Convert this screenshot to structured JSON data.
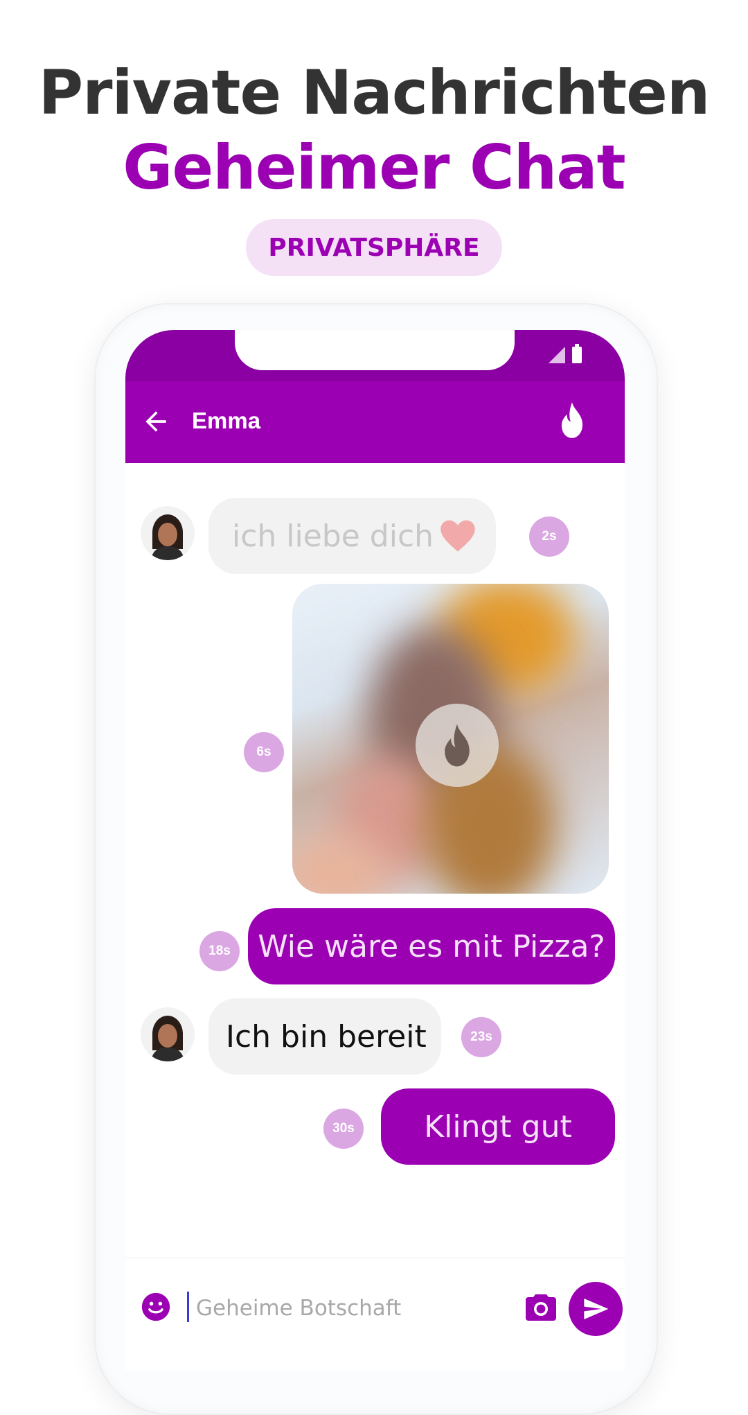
{
  "promo": {
    "title_line1": "Private Nachrichten",
    "title_line2": "Geheimer Chat",
    "badge": "PRIVATSPHÄRE"
  },
  "chat": {
    "contact_name": "Emma",
    "messages": [
      {
        "direction": "incoming",
        "text": "ich liebe dich",
        "emoji": "heart",
        "timer": "2s",
        "burning": true
      },
      {
        "direction": "outgoing",
        "type": "photo",
        "timer": "6s",
        "blurred": true
      },
      {
        "direction": "outgoing",
        "text": "Wie wäre es mit Pizza?",
        "timer": "18s"
      },
      {
        "direction": "incoming",
        "text": "Ich bin bereit",
        "timer": "23s"
      },
      {
        "direction": "outgoing",
        "text": "Klingt gut",
        "timer": "30s"
      }
    ],
    "composer": {
      "placeholder": "Geheime Botschaft",
      "value": ""
    }
  },
  "icons": {
    "back": "arrow-left-icon",
    "burn": "flame-icon",
    "emoji": "smiley-icon",
    "camera": "camera-icon",
    "send": "send-icon"
  },
  "colors": {
    "brand": "#9b00b3",
    "status_bar": "#8a00a2",
    "timer_badge": "#dba7e3",
    "badge_bg": "#f5e1f6",
    "headline": "#333333"
  }
}
